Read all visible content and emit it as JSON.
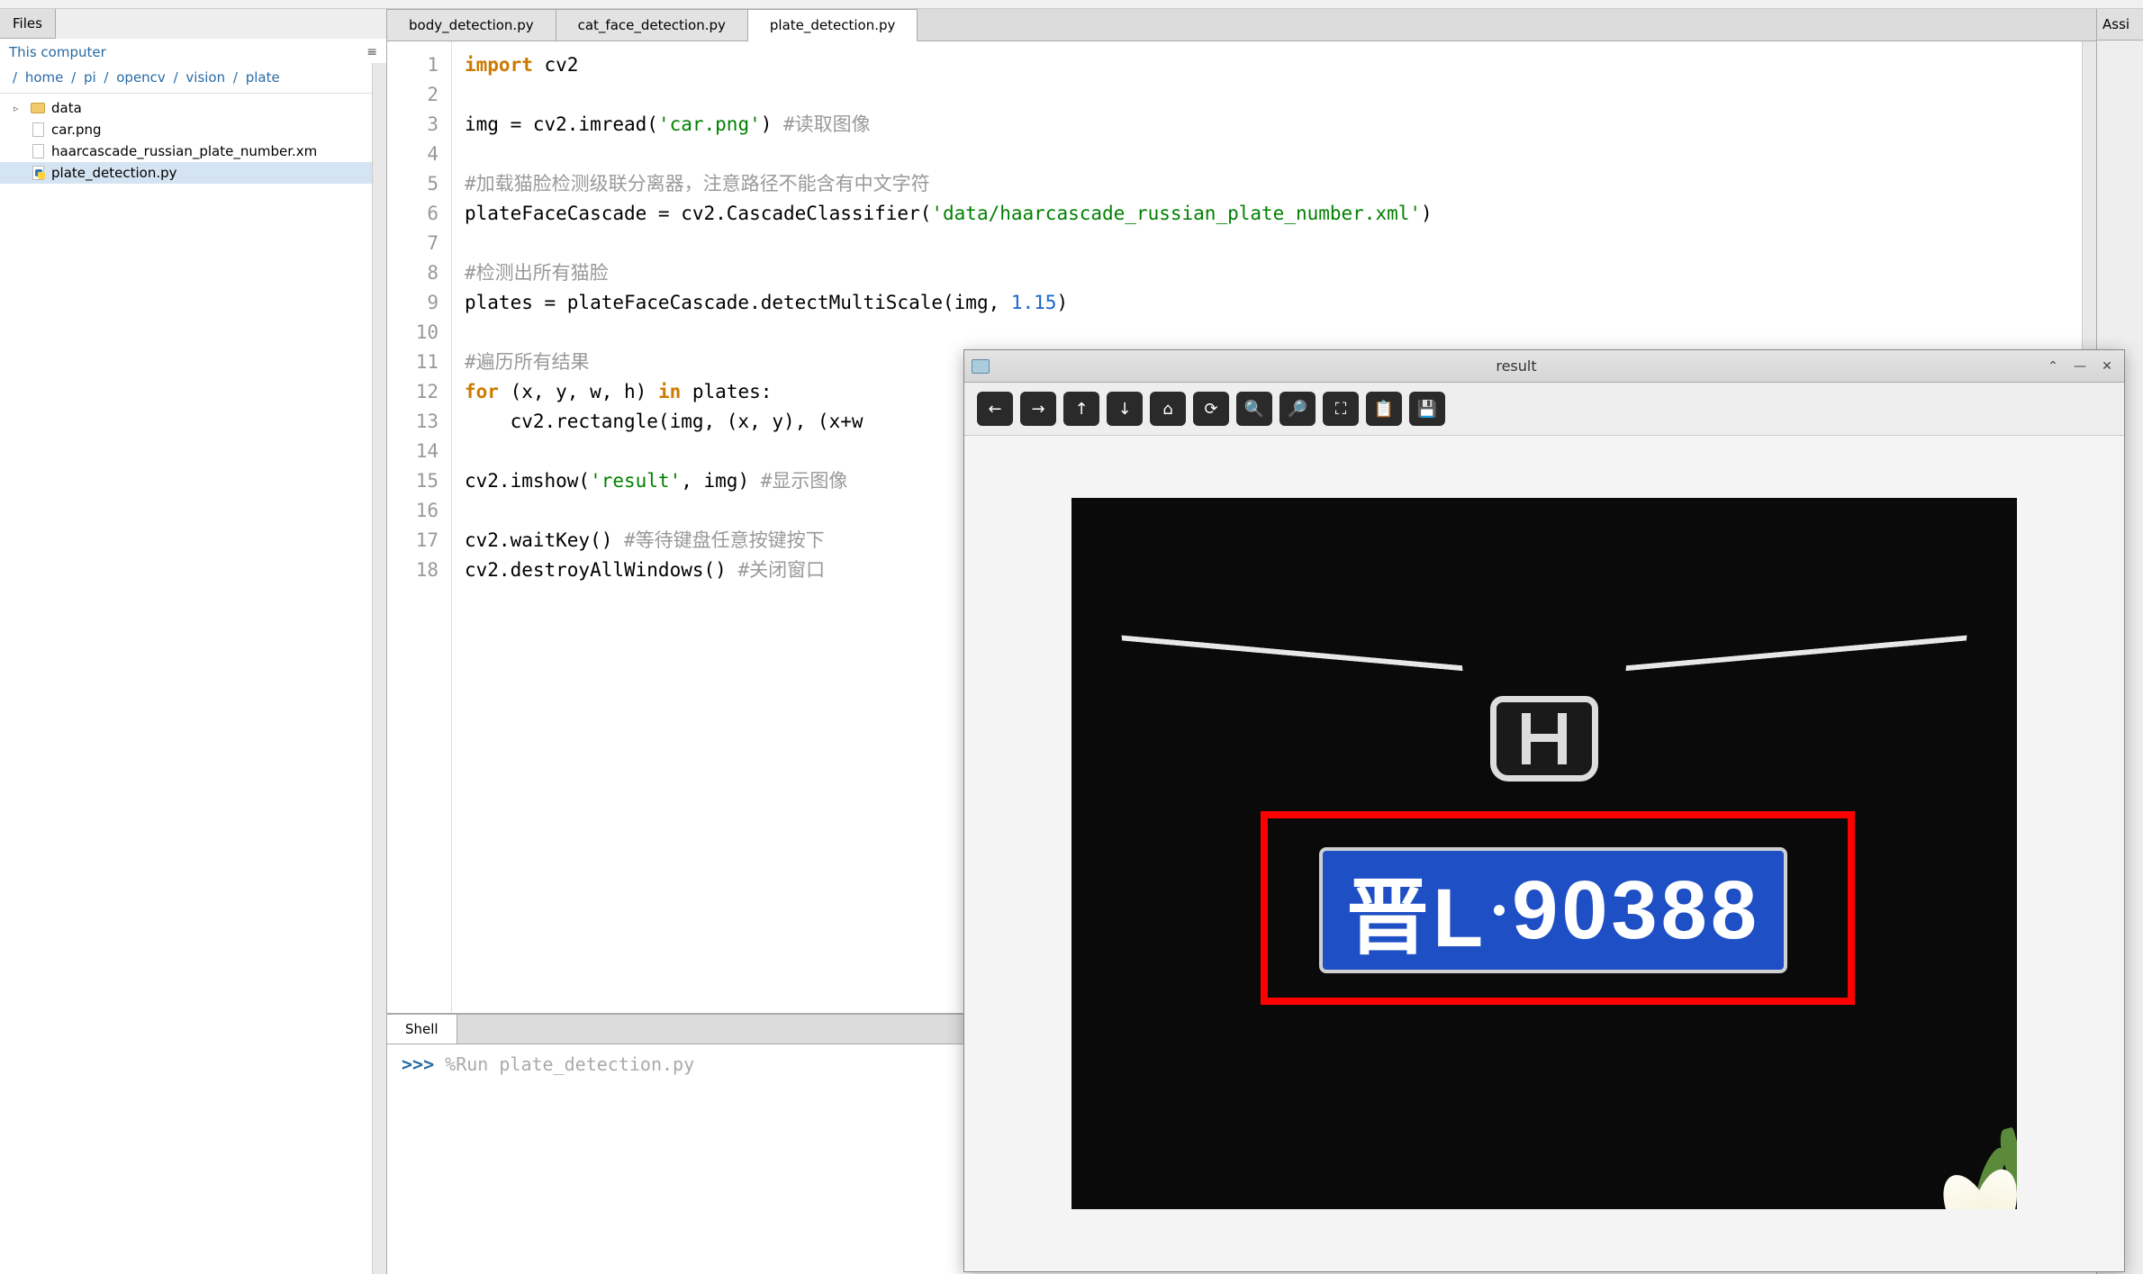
{
  "files_panel": {
    "tab_label": "Files",
    "header": "This computer",
    "breadcrumb": [
      "home",
      "pi",
      "opencv",
      "vision",
      "plate"
    ],
    "tree": [
      {
        "type": "folder",
        "name": "data",
        "expandable": true
      },
      {
        "type": "file",
        "name": "car.png"
      },
      {
        "type": "file",
        "name": "haarcascade_russian_plate_number.xm"
      },
      {
        "type": "pyfile",
        "name": "plate_detection.py",
        "selected": true
      }
    ]
  },
  "editor": {
    "tabs": [
      {
        "label": "body_detection.py",
        "active": false
      },
      {
        "label": "cat_face_detection.py",
        "active": false
      },
      {
        "label": "plate_detection.py",
        "active": true
      }
    ],
    "lines": [
      [
        {
          "t": "kw",
          "v": "import"
        },
        {
          "t": "",
          "v": " cv2"
        }
      ],
      [],
      [
        {
          "t": "",
          "v": "img = cv2.imread("
        },
        {
          "t": "str",
          "v": "'car.png'"
        },
        {
          "t": "",
          "v": ") "
        },
        {
          "t": "com",
          "v": "#读取图像"
        }
      ],
      [],
      [
        {
          "t": "com",
          "v": "#加载猫脸检测级联分离器，注意路径不能含有中文字符"
        }
      ],
      [
        {
          "t": "",
          "v": "plateFaceCascade = cv2.CascadeClassifier("
        },
        {
          "t": "str",
          "v": "'data/haarcascade_russian_plate_number.xml'"
        },
        {
          "t": "",
          "v": ")"
        }
      ],
      [],
      [
        {
          "t": "com",
          "v": "#检测出所有猫脸"
        }
      ],
      [
        {
          "t": "",
          "v": "plates = plateFaceCascade.detectMultiScale(img, "
        },
        {
          "t": "num",
          "v": "1.15"
        },
        {
          "t": "",
          "v": ")"
        }
      ],
      [],
      [
        {
          "t": "com",
          "v": "#遍历所有结果"
        }
      ],
      [
        {
          "t": "kw",
          "v": "for"
        },
        {
          "t": "",
          "v": " (x, y, w, h) "
        },
        {
          "t": "kw",
          "v": "in"
        },
        {
          "t": "",
          "v": " plates:"
        }
      ],
      [
        {
          "t": "",
          "v": "    cv2.rectangle(img, (x, y), (x+w"
        }
      ],
      [],
      [
        {
          "t": "",
          "v": "cv2.imshow("
        },
        {
          "t": "str",
          "v": "'result'"
        },
        {
          "t": "",
          "v": ", img) "
        },
        {
          "t": "com",
          "v": "#显示图像"
        }
      ],
      [],
      [
        {
          "t": "",
          "v": "cv2.waitKey() "
        },
        {
          "t": "com",
          "v": "#等待键盘任意按键按下"
        }
      ],
      [
        {
          "t": "",
          "v": "cv2.destroyAllWindows() "
        },
        {
          "t": "com",
          "v": "#关闭窗口"
        }
      ]
    ]
  },
  "shell": {
    "tab_label": "Shell",
    "prompt": ">>>",
    "command": "%Run plate_detection.py"
  },
  "right_panel": {
    "tab_label": "Assi"
  },
  "result_window": {
    "title": "result",
    "plate_text_prefix": "晋L",
    "plate_text_number": "90388",
    "toolbar_icons": [
      "arrow-left",
      "arrow-right",
      "arrow-up",
      "arrow-down",
      "home",
      "rotate",
      "zoom-in",
      "zoom-out",
      "fit",
      "clipboard",
      "save"
    ]
  }
}
